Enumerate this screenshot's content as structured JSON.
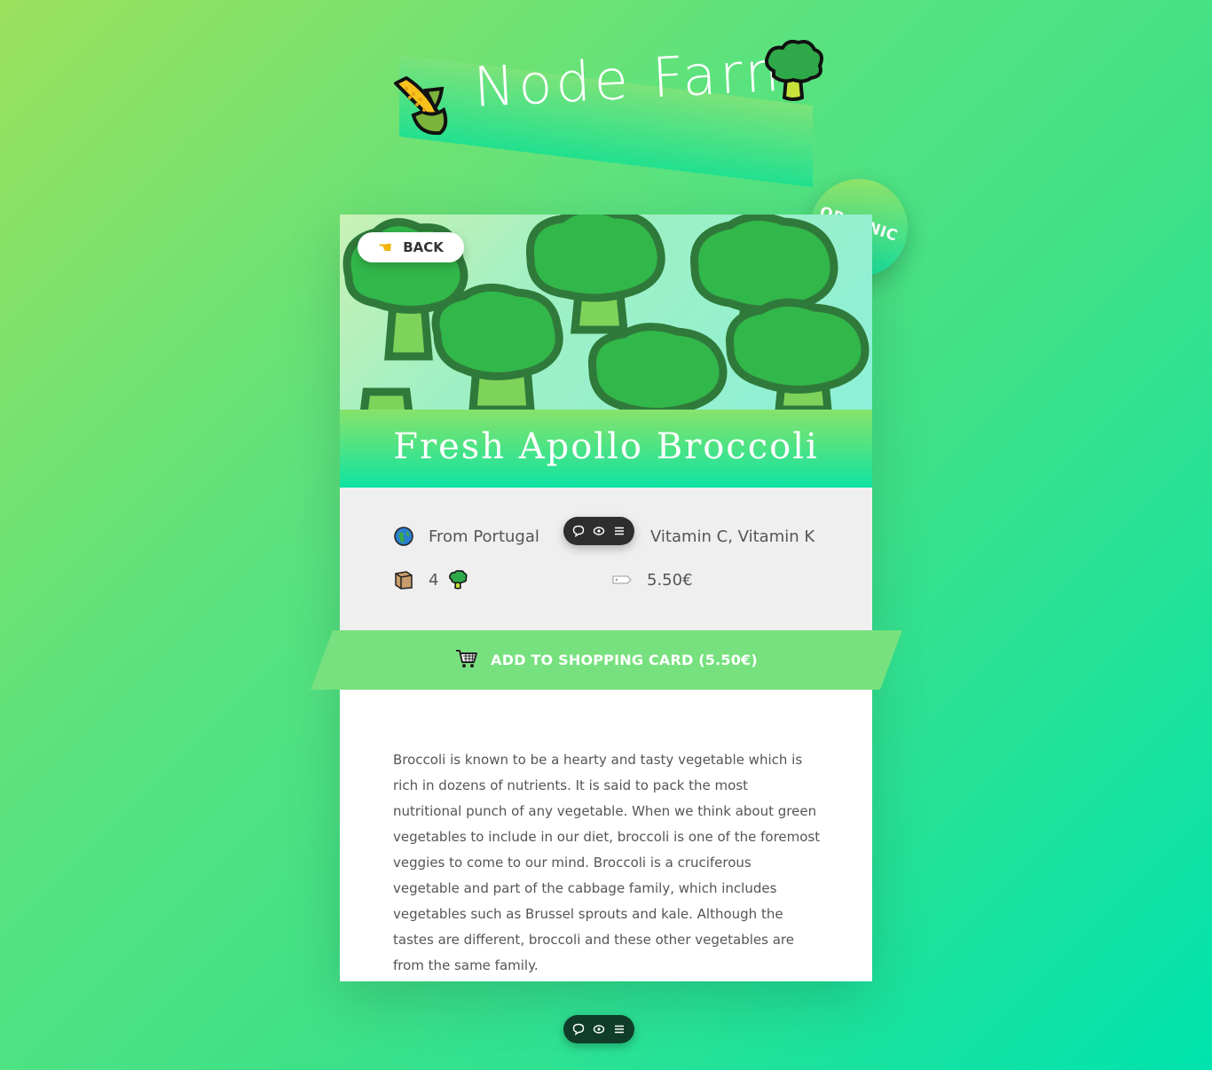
{
  "header": {
    "title": "Node Farm"
  },
  "product": {
    "name": "Fresh Apollo Broccoli",
    "badge": "ORGANIC",
    "back_label": "BACK",
    "origin": "From Portugal",
    "nutrients": "Vitamin C, Vitamin K",
    "quantity": "4",
    "price": "5.50€",
    "add_label": "ADD TO SHOPPING CARD (5.50€)",
    "description": "Broccoli is known to be a hearty and tasty vegetable which is rich in dozens of nutrients. It is said to pack the most nutritional punch of any vegetable. When we think about green vegetables to include in our diet, broccoli is one of the foremost veggies to come to our mind. Broccoli is a cruciferous vegetable and part of the cabbage family, which includes vegetables such as Brussel sprouts and kale. Although the tastes are different, broccoli and these other vegetables are from the same family."
  },
  "icons": {
    "corn": "corn-icon",
    "broccoli": "broccoli-icon",
    "back": "pointing-hand-icon",
    "origin": "globe-icon",
    "nutrients": "muscle-icon",
    "quantity": "box-icon",
    "price": "price-tag-icon",
    "cart": "shopping-cart-icon",
    "toolbar": [
      "comment-icon",
      "eye-icon",
      "menu-icon"
    ]
  },
  "colors": {
    "accent_green": "#77e17f",
    "teal": "#00e3ae",
    "card_details_bg": "#efefef"
  }
}
